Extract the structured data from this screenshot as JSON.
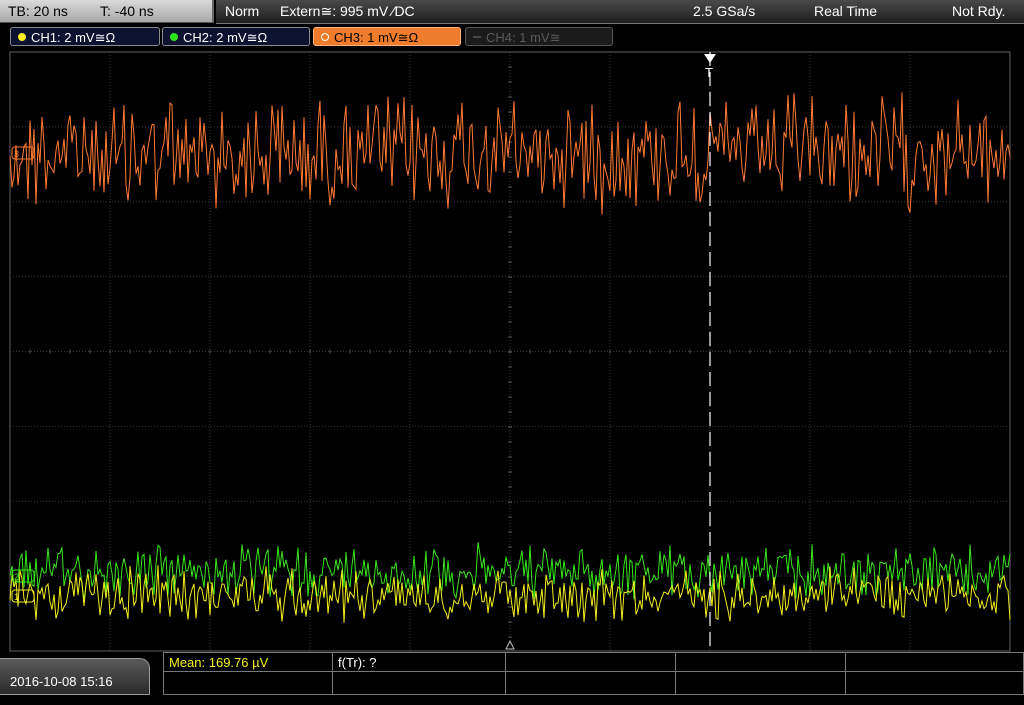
{
  "timebase": {
    "tb": "TB: 20 ns",
    "trigger_offset": "T: -40 ns"
  },
  "status": {
    "mode": "Norm",
    "trigger": "Extern≅: 995 mV ⁄DC",
    "sample_rate": "2.5 GSa/s",
    "acquisition": "Real Time",
    "state": "Not Rdy."
  },
  "channels": [
    {
      "id": "ch1",
      "label": "CH1: 2 mV≅Ω",
      "color": "#f5f01e",
      "active": false
    },
    {
      "id": "ch2",
      "label": "CH2: 2 mV≅Ω",
      "color": "#2ee31a",
      "active": false
    },
    {
      "id": "ch3",
      "label": "CH3: 1 mV≅Ω",
      "color": "#ef7b2c",
      "active": true
    },
    {
      "id": "ch4",
      "label": "CH4: 1 mV≅",
      "color": "#4a4a4a",
      "active": false
    }
  ],
  "trigger_marker": {
    "label": "T"
  },
  "measurements": {
    "mean": "Mean: 169.76 µV",
    "freq": "f(Tr): ?"
  },
  "datetime": "2016-10-08 15:16",
  "colors": {
    "ch3_trace": "#ff7a33",
    "ch2_trace": "#39e61c",
    "ch1_trace": "#f2ee1e",
    "grid": "#3a3a3a",
    "trigger_line": "#ffffff",
    "mean_text": "#f5f01e"
  }
}
